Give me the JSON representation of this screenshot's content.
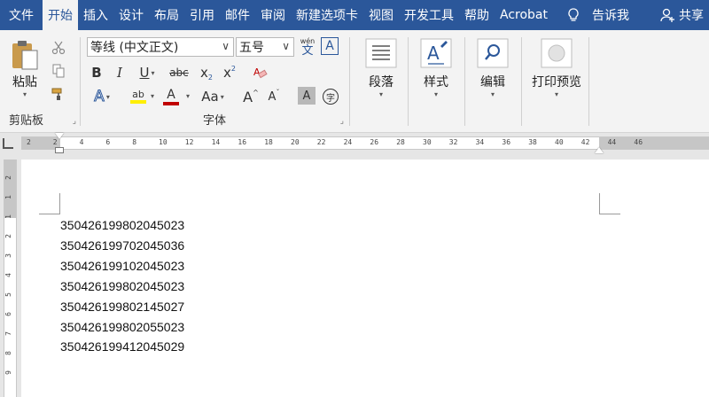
{
  "tabs": [
    "文件",
    "开始",
    "插入",
    "设计",
    "布局",
    "引用",
    "邮件",
    "审阅",
    "新建选项卡",
    "视图",
    "开发工具",
    "帮助",
    "Acrobat"
  ],
  "active_tab": "开始",
  "tell_me": "告诉我",
  "share": "共享",
  "clipboard": {
    "paste": "粘贴",
    "label": "剪贴板"
  },
  "font": {
    "family": "等线 (中文正文)",
    "size": "五号",
    "phonetic_top": "wén",
    "phonetic_bottom": "文",
    "border_char": "A",
    "bold": "B",
    "italic": "I",
    "underline": "U",
    "strike": "abc",
    "subscript": "x",
    "superscript": "x",
    "text_effect": "A",
    "highlight": "ab",
    "font_color": "A",
    "change_case": "Aa",
    "grow": "A",
    "shrink": "A",
    "char_shading": "A",
    "enclose": "字",
    "label": "字体"
  },
  "groups": {
    "paragraph": "段落",
    "styles": "样式",
    "editing": "编辑",
    "print_preview": "打印预览"
  },
  "ruler_numbers": [
    "2",
    "2",
    "4",
    "6",
    "8",
    "10",
    "12",
    "14",
    "16",
    "18",
    "20",
    "22",
    "24",
    "26",
    "28",
    "30",
    "32",
    "34",
    "36",
    "38",
    "40",
    "42",
    "44",
    "46"
  ],
  "vruler_numbers": [
    "2",
    "1",
    "1",
    "2",
    "3",
    "4",
    "5",
    "6",
    "7",
    "8",
    "9"
  ],
  "document": {
    "lines": [
      "350426199802045023",
      "350426199702045036",
      "350426199102045023",
      "350426199802045023",
      "350426199802145027",
      "350426199802055023",
      "350426199412045029"
    ]
  },
  "colors": {
    "accent": "#2b579a",
    "highlight": "#ffef00",
    "font_color": "#c00000"
  }
}
